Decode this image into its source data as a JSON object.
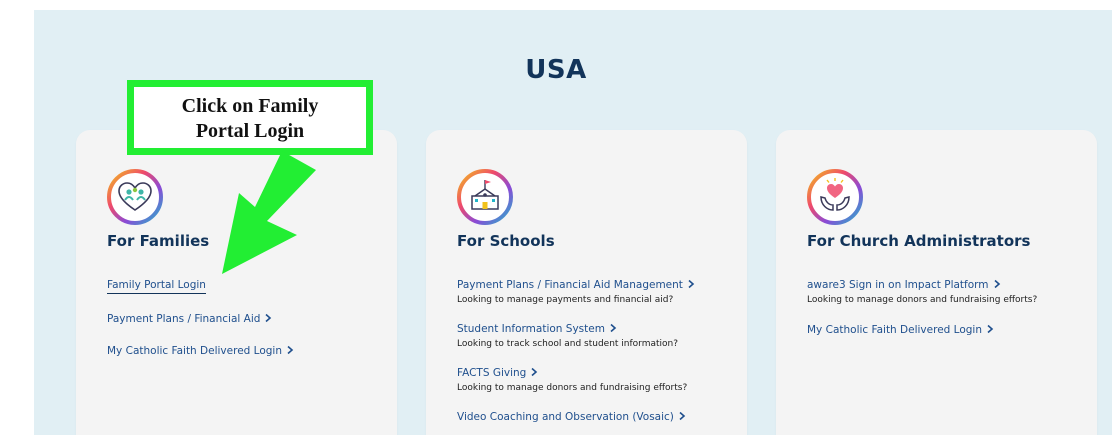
{
  "colors": {
    "band_background": "#e1eff4",
    "card_background": "#f4f4f4",
    "heading": "#12345a",
    "link": "#1f4f8d",
    "annotation_green": "#22ee33"
  },
  "region": {
    "title": "USA"
  },
  "annotation": {
    "line1": "Click on Family",
    "line2": "Portal Login"
  },
  "cards": [
    {
      "icon": "family-heart-icon",
      "title": "For Families",
      "links": [
        {
          "label": "Family Portal Login",
          "chevron": false,
          "description": ""
        },
        {
          "label": "Payment Plans / Financial Aid",
          "chevron": true,
          "description": ""
        },
        {
          "label": "My Catholic Faith Delivered Login",
          "chevron": true,
          "description": ""
        }
      ]
    },
    {
      "icon": "school-building-icon",
      "title": "For Schools",
      "links": [
        {
          "label": "Payment Plans / Financial Aid Management",
          "chevron": true,
          "description": "Looking to manage payments and financial aid?"
        },
        {
          "label": "Student Information System",
          "chevron": true,
          "description": "Looking to track school and student information?"
        },
        {
          "label": "FACTS Giving",
          "chevron": true,
          "description": "Looking to manage donors and fundraising efforts?"
        },
        {
          "label": "Video Coaching and Observation (Vosaic)",
          "chevron": true,
          "description": ""
        }
      ]
    },
    {
      "icon": "hands-heart-icon",
      "title": "For Church Administrators",
      "links": [
        {
          "label": "aware3 Sign in on Impact Platform",
          "chevron": true,
          "description": "Looking to manage donors and fundraising efforts?"
        },
        {
          "label": "My Catholic Faith Delivered Login",
          "chevron": true,
          "description": ""
        }
      ]
    }
  ]
}
